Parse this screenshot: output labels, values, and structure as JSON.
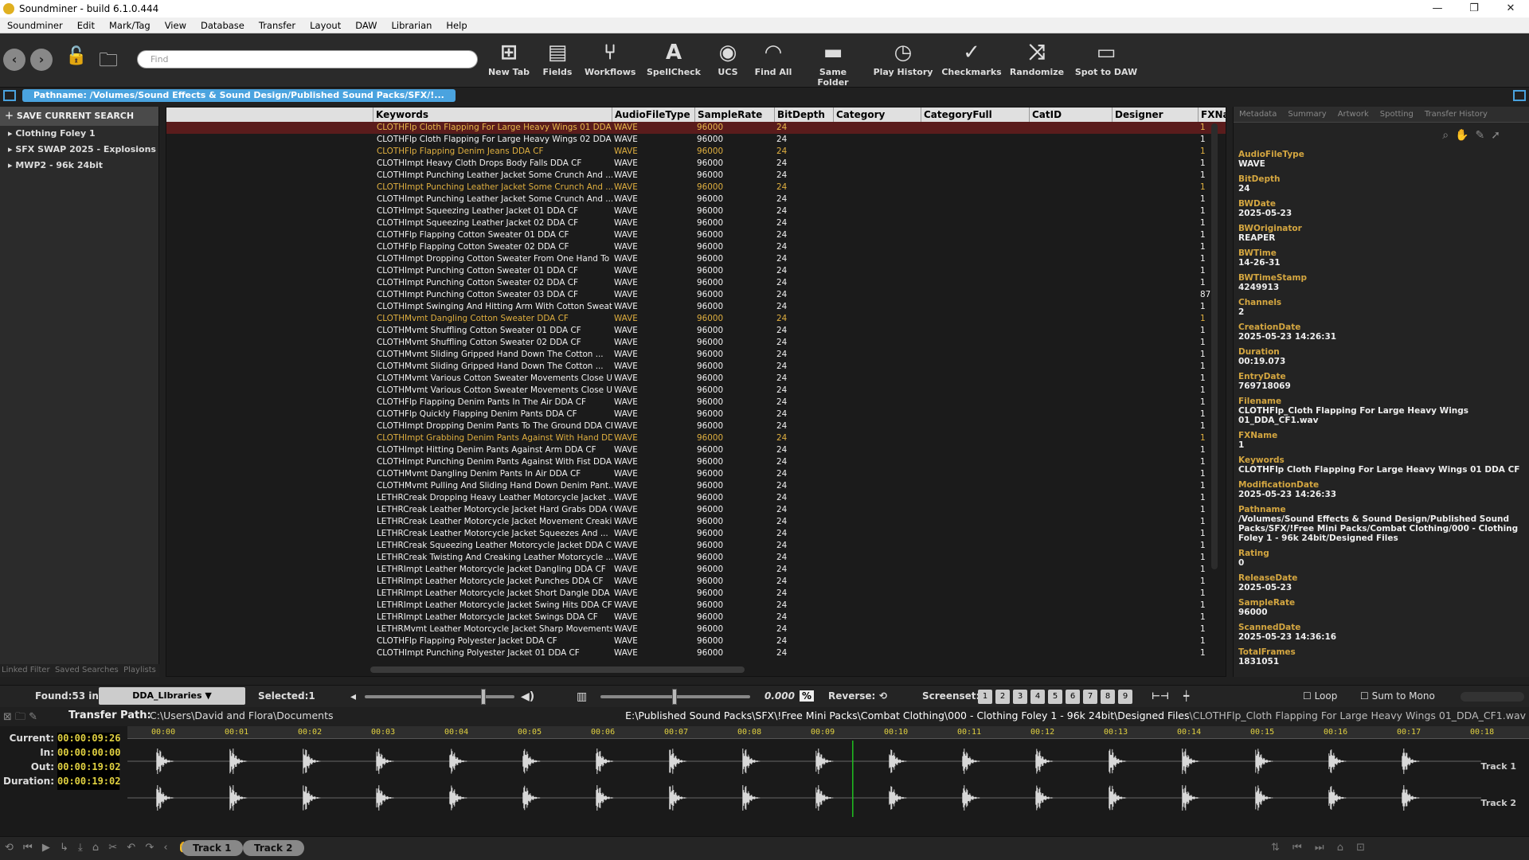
{
  "app": {
    "title": "Soundminer - build 6.1.0.444"
  },
  "menu": [
    "Soundminer",
    "Edit",
    "Mark/Tag",
    "View",
    "Database",
    "Transfer",
    "Layout",
    "DAW",
    "Librarian",
    "Help"
  ],
  "search": {
    "placeholder": "Find"
  },
  "toolbar": [
    {
      "label": "New Tab",
      "icon": "new-tab-icon"
    },
    {
      "label": "Fields",
      "icon": "fields-icon"
    },
    {
      "label": "Workflows",
      "icon": "workflows-icon"
    },
    {
      "label": "SpellCheck",
      "icon": "spellcheck-icon"
    },
    {
      "label": "UCS",
      "icon": "ucs-icon"
    },
    {
      "label": "Find All",
      "icon": "find-all-icon"
    },
    {
      "label": "Same Folder",
      "icon": "folder-icon"
    },
    {
      "label": "Play History",
      "icon": "history-icon"
    },
    {
      "label": "Checkmarks",
      "icon": "checkmark-icon"
    },
    {
      "label": "Randomize",
      "icon": "shuffle-icon"
    },
    {
      "label": "Spot to DAW",
      "icon": "monitor-icon"
    }
  ],
  "pathname": "Pathname: /Volumes/Sound Effects & Sound Design/Published Sound Packs/SFX/!...",
  "left": {
    "header": "SAVE CURRENT SEARCH",
    "items": [
      "Clothing Foley 1",
      "SFX SWAP 2025 - Explosions",
      "MWP2 - 96k 24bit"
    ],
    "footer": [
      "Linked Filter",
      "Saved Searches",
      "Playlists"
    ]
  },
  "columns": [
    "Keywords",
    "AudioFileType",
    "SampleRate",
    "BitDepth",
    "Category",
    "CategoryFull",
    "CatID",
    "Designer",
    "FXNar"
  ],
  "rows": [
    {
      "k": "CLOTHFlp Cloth Flapping For Large Heavy Wings 01 DDA ...",
      "t": "WAVE",
      "s": "96000",
      "b": "24",
      "f": "1",
      "st": "sel"
    },
    {
      "k": "CLOTHFlp Cloth Flapping For Large Heavy Wings 02 DDA ...",
      "t": "WAVE",
      "s": "96000",
      "b": "24",
      "f": "1",
      "st": ""
    },
    {
      "k": "CLOTHFlp Flapping Denim Jeans DDA CF",
      "t": "WAVE",
      "s": "96000",
      "b": "24",
      "f": "1",
      "st": "hl"
    },
    {
      "k": "CLOTHImpt Heavy Cloth Drops Body Falls DDA CF",
      "t": "WAVE",
      "s": "96000",
      "b": "24",
      "f": "1",
      "st": ""
    },
    {
      "k": "CLOTHImpt Punching Leather Jacket Some Crunch And ...",
      "t": "WAVE",
      "s": "96000",
      "b": "24",
      "f": "1",
      "st": ""
    },
    {
      "k": "CLOTHImpt Punching Leather Jacket Some Crunch And ...",
      "t": "WAVE",
      "s": "96000",
      "b": "24",
      "f": "1",
      "st": "hl"
    },
    {
      "k": "CLOTHImpt Punching Leather Jacket Some Crunch And ...",
      "t": "WAVE",
      "s": "96000",
      "b": "24",
      "f": "1",
      "st": ""
    },
    {
      "k": "CLOTHImpt Squeezing Leather Jacket 01 DDA CF",
      "t": "WAVE",
      "s": "96000",
      "b": "24",
      "f": "1",
      "st": ""
    },
    {
      "k": "CLOTHImpt Squeezing Leather Jacket 02 DDA CF",
      "t": "WAVE",
      "s": "96000",
      "b": "24",
      "f": "1",
      "st": ""
    },
    {
      "k": "CLOTHFlp Flapping Cotton Sweater 01 DDA CF",
      "t": "WAVE",
      "s": "96000",
      "b": "24",
      "f": "1",
      "st": ""
    },
    {
      "k": "CLOTHFlp Flapping Cotton Sweater 02 DDA CF",
      "t": "WAVE",
      "s": "96000",
      "b": "24",
      "f": "1",
      "st": ""
    },
    {
      "k": "CLOTHImpt Dropping Cotton Sweater From One Hand To ...",
      "t": "WAVE",
      "s": "96000",
      "b": "24",
      "f": "1",
      "st": ""
    },
    {
      "k": "CLOTHImpt Punching Cotton Sweater 01 DDA CF",
      "t": "WAVE",
      "s": "96000",
      "b": "24",
      "f": "1",
      "st": ""
    },
    {
      "k": "CLOTHImpt Punching Cotton Sweater 02 DDA CF",
      "t": "WAVE",
      "s": "96000",
      "b": "24",
      "f": "1",
      "st": ""
    },
    {
      "k": "CLOTHImpt Punching Cotton Sweater 03 DDA CF",
      "t": "WAVE",
      "s": "96000",
      "b": "24",
      "f": "87",
      "st": ""
    },
    {
      "k": "CLOTHImpt Swinging And Hitting Arm With Cotton Sweat...",
      "t": "WAVE",
      "s": "96000",
      "b": "24",
      "f": "1",
      "st": ""
    },
    {
      "k": "CLOTHMvmt Dangling Cotton Sweater DDA CF",
      "t": "WAVE",
      "s": "96000",
      "b": "24",
      "f": "1",
      "st": "hl"
    },
    {
      "k": "CLOTHMvmt Shuffling Cotton Sweater 01 DDA CF",
      "t": "WAVE",
      "s": "96000",
      "b": "24",
      "f": "1",
      "st": ""
    },
    {
      "k": "CLOTHMvmt Shuffling Cotton Sweater 02 DDA CF",
      "t": "WAVE",
      "s": "96000",
      "b": "24",
      "f": "1",
      "st": ""
    },
    {
      "k": "CLOTHMvmt Sliding Gripped Hand Down The Cotton ...",
      "t": "WAVE",
      "s": "96000",
      "b": "24",
      "f": "1",
      "st": ""
    },
    {
      "k": "CLOTHMvmt Sliding Gripped Hand Down The Cotton ...",
      "t": "WAVE",
      "s": "96000",
      "b": "24",
      "f": "1",
      "st": ""
    },
    {
      "k": "CLOTHMvmt Various Cotton Sweater Movements Close U...",
      "t": "WAVE",
      "s": "96000",
      "b": "24",
      "f": "1",
      "st": ""
    },
    {
      "k": "CLOTHMvmt Various Cotton Sweater Movements Close U...",
      "t": "WAVE",
      "s": "96000",
      "b": "24",
      "f": "1",
      "st": ""
    },
    {
      "k": "CLOTHFlp Flapping Denim Pants In The Air DDA CF",
      "t": "WAVE",
      "s": "96000",
      "b": "24",
      "f": "1",
      "st": ""
    },
    {
      "k": "CLOTHFlp Quickly Flapping Denim Pants DDA CF",
      "t": "WAVE",
      "s": "96000",
      "b": "24",
      "f": "1",
      "st": ""
    },
    {
      "k": "CLOTHImpt Dropping Denim Pants To The Ground DDA CF",
      "t": "WAVE",
      "s": "96000",
      "b": "24",
      "f": "1",
      "st": ""
    },
    {
      "k": "CLOTHImpt Grabbing Denim Pants Against With Hand DD...",
      "t": "WAVE",
      "s": "96000",
      "b": "24",
      "f": "1",
      "st": "hl"
    },
    {
      "k": "CLOTHImpt Hitting Denim Pants Against Arm DDA CF",
      "t": "WAVE",
      "s": "96000",
      "b": "24",
      "f": "1",
      "st": ""
    },
    {
      "k": "CLOTHImpt Punching Denim Pants Against With Fist DDA...",
      "t": "WAVE",
      "s": "96000",
      "b": "24",
      "f": "1",
      "st": ""
    },
    {
      "k": "CLOTHMvmt Dangling Denim Pants In Air DDA CF",
      "t": "WAVE",
      "s": "96000",
      "b": "24",
      "f": "1",
      "st": ""
    },
    {
      "k": "CLOTHMvmt Pulling And Sliding Hand Down Denim Pant...",
      "t": "WAVE",
      "s": "96000",
      "b": "24",
      "f": "1",
      "st": ""
    },
    {
      "k": "LETHRCreak Dropping Heavy Leather Motorcycle Jacket ...",
      "t": "WAVE",
      "s": "96000",
      "b": "24",
      "f": "1",
      "st": ""
    },
    {
      "k": "LETHRCreak Leather Motorcycle Jacket Hard Grabs DDA CF",
      "t": "WAVE",
      "s": "96000",
      "b": "24",
      "f": "1",
      "st": ""
    },
    {
      "k": "LETHRCreak Leather Motorcycle Jacket Movement Creaki...",
      "t": "WAVE",
      "s": "96000",
      "b": "24",
      "f": "1",
      "st": ""
    },
    {
      "k": "LETHRCreak Leather Motorcycle Jacket Squeezes And ...",
      "t": "WAVE",
      "s": "96000",
      "b": "24",
      "f": "1",
      "st": ""
    },
    {
      "k": "LETHRCreak Squeezing Leather Motorcycle Jacket DDA CF",
      "t": "WAVE",
      "s": "96000",
      "b": "24",
      "f": "1",
      "st": ""
    },
    {
      "k": "LETHRCreak Twisting And Creaking Leather Motorcycle ...",
      "t": "WAVE",
      "s": "96000",
      "b": "24",
      "f": "1",
      "st": ""
    },
    {
      "k": "LETHRImpt Leather Motorcycle Jacket Dangling DDA CF",
      "t": "WAVE",
      "s": "96000",
      "b": "24",
      "f": "1",
      "st": ""
    },
    {
      "k": "LETHRImpt Leather Motorcycle Jacket Punches DDA CF",
      "t": "WAVE",
      "s": "96000",
      "b": "24",
      "f": "1",
      "st": ""
    },
    {
      "k": "LETHRImpt Leather Motorcycle Jacket Short Dangle DDA ...",
      "t": "WAVE",
      "s": "96000",
      "b": "24",
      "f": "1",
      "st": ""
    },
    {
      "k": "LETHRImpt Leather Motorcycle Jacket Swing Hits DDA CF",
      "t": "WAVE",
      "s": "96000",
      "b": "24",
      "f": "1",
      "st": ""
    },
    {
      "k": "LETHRImpt Leather Motorcycle Jacket Swings DDA CF",
      "t": "WAVE",
      "s": "96000",
      "b": "24",
      "f": "1",
      "st": ""
    },
    {
      "k": "LETHRMvmt Leather Motorcycle Jacket Sharp Movements...",
      "t": "WAVE",
      "s": "96000",
      "b": "24",
      "f": "1",
      "st": ""
    },
    {
      "k": "CLOTHFlp Flapping Polyester Jacket DDA CF",
      "t": "WAVE",
      "s": "96000",
      "b": "24",
      "f": "1",
      "st": ""
    },
    {
      "k": "CLOTHImpt Punching Polyester Jacket 01 DDA CF",
      "t": "WAVE",
      "s": "96000",
      "b": "24",
      "f": "1",
      "st": ""
    }
  ],
  "right": {
    "tabs": [
      "Metadata",
      "Summary",
      "Artwork",
      "Spotting",
      "Transfer History"
    ],
    "fields": [
      {
        "k": "AudioFileType",
        "v": "WAVE"
      },
      {
        "k": "BitDepth",
        "v": "24"
      },
      {
        "k": "BWDate",
        "v": "2025-05-23"
      },
      {
        "k": "BWOriginator",
        "v": "REAPER"
      },
      {
        "k": "BWTime",
        "v": "14-26-31"
      },
      {
        "k": "BWTimeStamp",
        "v": "4249913"
      },
      {
        "k": "Channels",
        "v": "2"
      },
      {
        "k": "CreationDate",
        "v": "2025-05-23 14:26:31"
      },
      {
        "k": "Duration",
        "v": "00:19.073"
      },
      {
        "k": "EntryDate",
        "v": "769718069"
      },
      {
        "k": "Filename",
        "v": "CLOTHFlp_Cloth Flapping For Large Heavy Wings 01_DDA_CF1.wav"
      },
      {
        "k": "FXName",
        "v": "1"
      },
      {
        "k": "Keywords",
        "v": "CLOTHFlp Cloth Flapping For Large Heavy Wings 01 DDA CF"
      },
      {
        "k": "ModificationDate",
        "v": "2025-05-23 14:26:33"
      },
      {
        "k": "Pathname",
        "v": "/Volumes/Sound Effects & Sound Design/Published Sound Packs/SFX/!Free Mini Packs/Combat Clothing/000 - Clothing Foley 1 - 96k 24bit/Designed Files"
      },
      {
        "k": "Rating",
        "v": "0"
      },
      {
        "k": "ReleaseDate",
        "v": "2025-05-23"
      },
      {
        "k": "SampleRate",
        "v": "96000"
      },
      {
        "k": "ScannedDate",
        "v": "2025-05-23 14:36:16"
      },
      {
        "k": "TotalFrames",
        "v": "1831051"
      }
    ]
  },
  "controls": {
    "found": "Found:53 in",
    "library": "DDA_LIbraries",
    "selected": "Selected:1",
    "pitch": "0.000",
    "pitch_unit": "%",
    "reverse": "Reverse:",
    "screenset": "Screenset:",
    "screensets": [
      "1",
      "2",
      "3",
      "4",
      "5",
      "6",
      "7",
      "8",
      "9"
    ],
    "loop": "Loop",
    "sum": "Sum to Mono"
  },
  "transfer": {
    "label": "Transfer Path:",
    "path": "C:\\Users\\David and Flora\\Documents",
    "file_dir": "E:\\Published Sound Packs\\SFX\\!Free Mini Packs\\Combat Clothing\\000 - Clothing Foley 1 - 96k 24bit\\Designed Files",
    "file_name": "\\CLOTHFlp_Cloth Flapping For Large Heavy Wings 01_DDA_CF1.wav"
  },
  "timecode": [
    {
      "k": "Current:",
      "v": "00:00:09:26"
    },
    {
      "k": "In:",
      "v": "00:00:00:00"
    },
    {
      "k": "Out:",
      "v": "00:00:19:02"
    },
    {
      "k": "Duration:",
      "v": "00:00:19:02"
    }
  ],
  "ruler": [
    "00:00",
    "00:01",
    "00:02",
    "00:03",
    "00:04",
    "00:05",
    "00:06",
    "00:07",
    "00:08",
    "00:09",
    "00:10",
    "00:11",
    "00:12",
    "00:13",
    "00:14",
    "00:15",
    "00:16",
    "00:17",
    "00:18"
  ],
  "tracks": [
    "Track 1",
    "Track 2"
  ],
  "bursts": [
    0.4,
    1.4,
    2.4,
    3.4,
    4.4,
    5.4,
    6.4,
    7.4,
    8.4,
    9.4,
    10.4,
    11.4,
    12.4,
    13.4,
    14.4,
    15.4,
    16.4,
    17.4
  ],
  "playhead": 9.9
}
